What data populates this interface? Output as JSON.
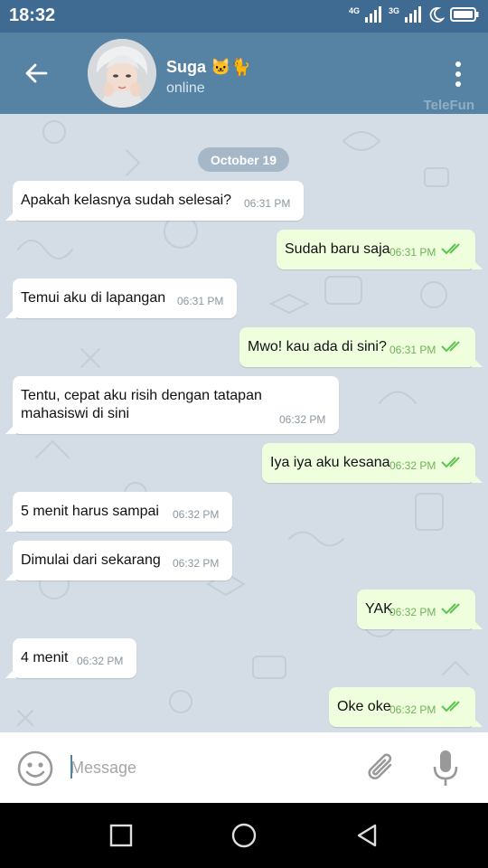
{
  "status_bar": {
    "time": "18:32",
    "network_1": "4G",
    "network_2": "3G",
    "icons": [
      "signal-icon",
      "signal-icon",
      "moon-icon",
      "battery-icon"
    ]
  },
  "header": {
    "contact_name": "Suga 🐱🐈",
    "contact_status": "online",
    "watermark": "TeleFun",
    "icons": [
      "back-arrow-icon",
      "contact-avatar",
      "more-vert-icon"
    ]
  },
  "chat": {
    "date": "October 19",
    "messages": [
      {
        "dir": "in",
        "text": "Apakah kelasnya sudah selesai?",
        "time": "06:31 PM"
      },
      {
        "dir": "out",
        "text": "Sudah baru saja",
        "time": "06:31 PM",
        "read": true
      },
      {
        "dir": "in",
        "text": "Temui aku di lapangan",
        "time": "06:31 PM"
      },
      {
        "dir": "out",
        "text": "Mwo! kau ada di sini?",
        "time": "06:31 PM",
        "read": true
      },
      {
        "dir": "in",
        "text": "Tentu, cepat aku risih dengan tatapan mahasiswi di sini",
        "time": "06:32 PM"
      },
      {
        "dir": "out",
        "text": "Iya iya aku kesana",
        "time": "06:32 PM",
        "read": true
      },
      {
        "dir": "in",
        "text": "5 menit harus sampai",
        "time": "06:32 PM"
      },
      {
        "dir": "in",
        "text": "Dimulai dari sekarang",
        "time": "06:32 PM"
      },
      {
        "dir": "out",
        "text": "YAK",
        "time": "06:32 PM",
        "read": true
      },
      {
        "dir": "in",
        "text": "4 menit",
        "time": "06:32 PM"
      },
      {
        "dir": "out",
        "text": "Oke oke",
        "time": "06:32 PM",
        "read": true
      }
    ]
  },
  "composer": {
    "placeholder": "Message",
    "value": "",
    "icons": [
      "emoji-icon",
      "attach-icon",
      "mic-icon"
    ]
  },
  "nav_bar": {
    "icons": [
      "recents-icon",
      "home-icon",
      "back-icon"
    ]
  },
  "colors": {
    "header": "#5682a3",
    "status_bar": "#3f6a91",
    "chat_background": "#d4dde6",
    "incoming_bubble": "#ffffff",
    "outgoing_bubble": "#effedd",
    "read_checks": "#5dc452"
  }
}
